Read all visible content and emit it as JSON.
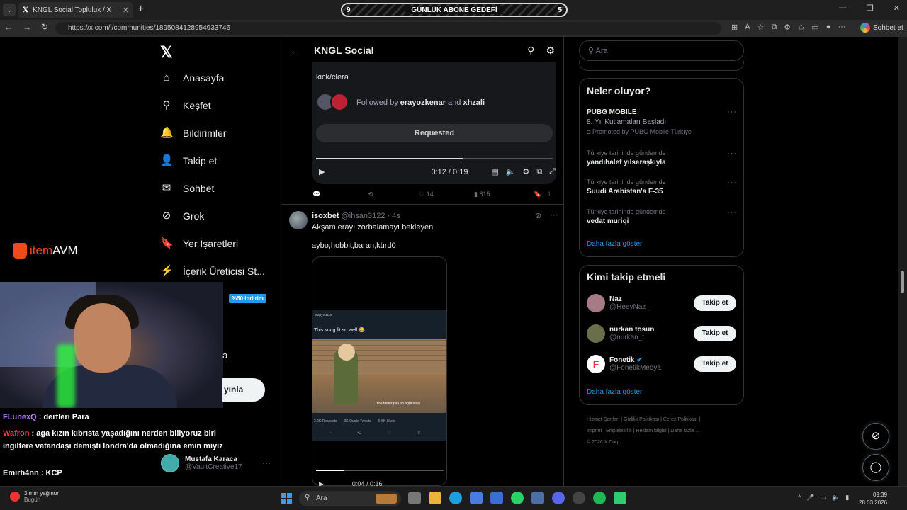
{
  "browser": {
    "tab_title": "KNGL Social Topluluk / X",
    "new_tab": "+",
    "url": "https://x.com/i/communities/1895084128954933746",
    "chat_label": "Sohbet et"
  },
  "goal_bar": {
    "left": "9",
    "label": "GÜNLÜK ABONE GEDEFİ",
    "right": "5"
  },
  "nav": {
    "items": [
      {
        "label": "Anasayfa",
        "icon": "⌂"
      },
      {
        "label": "Keşfet",
        "icon": "⚲"
      },
      {
        "label": "Bildirimler",
        "icon": "🔔"
      },
      {
        "label": "Takip et",
        "icon": "👤"
      },
      {
        "label": "Sohbet",
        "icon": "✉"
      },
      {
        "label": "Grok",
        "icon": "⊘"
      },
      {
        "label": "Yer İşaretleri",
        "icon": "🔖"
      },
      {
        "label": "İçerik Üreticisi St...",
        "icon": "⚡"
      }
    ],
    "more_partial": "a",
    "post_partial": "yınla"
  },
  "main": {
    "title": "KNGL Social",
    "card": {
      "handle": "kick/clera",
      "followed_prefix": "Followed by ",
      "followed_user1": "erayozkenar",
      "followed_and": " and ",
      "followed_user2": "xhzali",
      "request_button": "Requested",
      "time": "0:12 / 0:19",
      "progress": 0.62
    },
    "actions": {
      "likes": "14",
      "views": "815"
    },
    "tweet": {
      "name": "isoxbet",
      "handle": "@ihsan3122",
      "time": "· 4s",
      "line1": "Akşam erayı zorbalamayı bekleyen",
      "line2": "aybo,hobbit,baran,kürd0",
      "embed_header": "lexpyrcrzov",
      "embed_text": "This song fit so well 😂",
      "embed_caption": "You better pay up right now!",
      "embed_stats": [
        "2.2K Retweets",
        "2K Quote Tweets",
        "6.6K Likes"
      ],
      "video_time": "0:04 / 0:16",
      "video_progress": 0.22
    }
  },
  "right": {
    "search_placeholder": "Ara",
    "trends_title": "Neler oluyor?",
    "trends": [
      {
        "meta": "",
        "title": "PUBG MOBILE",
        "sub": "8. Yıl Kutlamaları Başladı!",
        "promo": "Promoted by PUBG Mobile Türkiye"
      },
      {
        "meta": "Türkiye tarihinde gündemde",
        "title": "yandıhalef yılseraşkıyla"
      },
      {
        "meta": "Türkiye tarihinde gündemde",
        "title": "Suudi Arabistan'a F-35"
      },
      {
        "meta": "Türkiye tarihinde gündemde",
        "title": "vedat muriqi"
      }
    ],
    "show_more": "Daha fazla göster",
    "who_title": "Kimi takip etmeli",
    "who": [
      {
        "name": "Naz",
        "handle": "@HeeyNaz_",
        "button": "Takip et"
      },
      {
        "name": "nurkan tosun",
        "handle": "@nurkan_t",
        "button": "Takip et"
      },
      {
        "name": "Fonetik",
        "handle": "@FonetikMedya",
        "button": "Takip et"
      }
    ],
    "footer_line1": "Hizmet Şartları  |  Gizlilik Politikası  |  Çerez Politikası  |",
    "footer_line2": "Imprint  |  Erişilebilirlik  |  Reklam bilgisi  |  Daha fazla ...",
    "footer_line3": "© 2026 X Corp."
  },
  "overlay": {
    "brand_a": "item",
    "brand_b": "AVM",
    "discount": "%50 indirim",
    "chat": [
      {
        "user": "FLunexQ",
        "color": "#b57bff",
        "text": " : dertleri Para"
      },
      {
        "user": "Wafron",
        "color": "#ff3b3b",
        "text": " : aga kızın kıbrısta yaşadığını nerden biliyoruz biri ingiltere vatandaşı demişti londra'da olmadığına emin miyiz"
      },
      {
        "user": "Emirh4nn",
        "color": "#ffffff",
        "text": " : KCP"
      }
    ],
    "account_name": "Mustafa Karaca",
    "account_handle": "@VaultCreative17"
  },
  "taskbar": {
    "weather": "3 mm yağmur",
    "weather_sub": "Bugün",
    "search": "Ara",
    "time": "09:39",
    "date": "28.03.2026"
  }
}
